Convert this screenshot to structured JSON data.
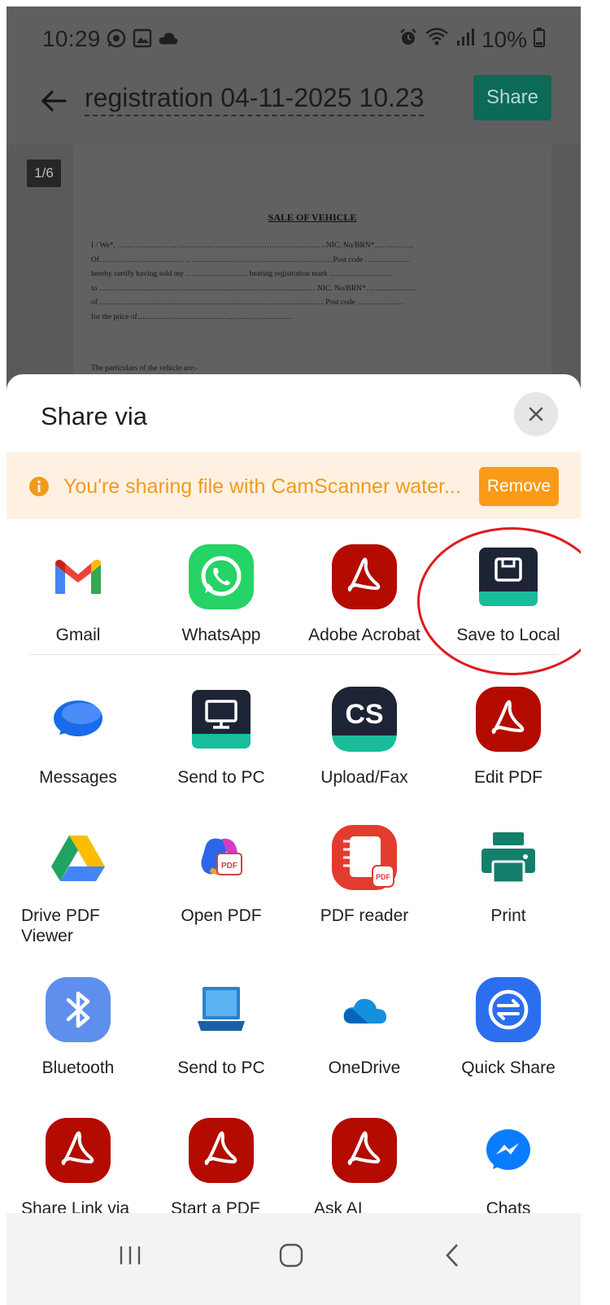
{
  "status_bar": {
    "time": "10:29",
    "battery": "10%",
    "left_icons": [
      "whatsapp-icon",
      "gallery-icon",
      "cloud-icon"
    ],
    "right_icons": [
      "alarm-icon",
      "wifi-icon",
      "signal-icon",
      "battery-icon"
    ]
  },
  "header": {
    "title": "registration 04-11-2025 10.23",
    "share_label": "Share"
  },
  "document": {
    "page_indicator": "1/6",
    "heading": "SALE OF VEHICLE",
    "lines": [
      "I / We*, ………………………………………………………………………NIC. No/BRN*……………",
      "Of…………………………… …………………………………………………Post code ………………",
      "hereby certify having sold my …………………… bearing registration mark ……………………",
      "to ………………………………………………………………………… NIC. No/BRN*. ………………",
      "of …………………………………………………………………………… Post code ………………",
      "for the price of……………………………………………………"
    ],
    "particulars": "The particulars of the vehicle are:-"
  },
  "sheet": {
    "title": "Share via",
    "banner_text": "You're sharing file with CamScanner water...",
    "remove_label": "Remove"
  },
  "apps": [
    [
      {
        "label": "Gmail",
        "icon": "gmail-icon"
      },
      {
        "label": "WhatsApp",
        "icon": "whatsapp-icon"
      },
      {
        "label": "Adobe Acrobat",
        "icon": "acrobat-icon"
      },
      {
        "label": "Save to Local",
        "icon": "save-icon"
      }
    ],
    [
      {
        "label": "Messages",
        "icon": "messages-icon"
      },
      {
        "label": "Send to PC",
        "icon": "monitor-icon"
      },
      {
        "label": "Upload/Fax",
        "icon": "camscanner-icon"
      },
      {
        "label": "Edit PDF",
        "icon": "acrobat-icon"
      }
    ],
    [
      {
        "label": "Drive PDF Viewer",
        "icon": "drive-icon"
      },
      {
        "label": "Open PDF",
        "icon": "copilot-pdf-icon"
      },
      {
        "label": "PDF reader",
        "icon": "pdf-reader-icon"
      },
      {
        "label": "Print",
        "icon": "printer-icon"
      }
    ],
    [
      {
        "label": "Bluetooth",
        "icon": "bluetooth-icon"
      },
      {
        "label": "Send to PC",
        "icon": "laptop-icon"
      },
      {
        "label": "OneDrive",
        "icon": "onedrive-icon"
      },
      {
        "label": "Quick Share",
        "icon": "quick-share-icon"
      }
    ],
    [
      {
        "label": "Share Link via Acrobat",
        "icon": "acrobat-icon"
      },
      {
        "label": "Start a PDF Space",
        "icon": "acrobat-icon"
      },
      {
        "label": "Ask AI Assistant",
        "icon": "acrobat-icon"
      },
      {
        "label": "Chats",
        "icon": "messenger-icon"
      }
    ]
  ],
  "nav": {
    "icons": [
      "recent-apps-icon",
      "home-icon",
      "back-icon"
    ]
  },
  "colors": {
    "share_green": "#0c6a58",
    "banner_bg": "#fff1e2",
    "banner_accent": "#fa9a17",
    "acrobat_red": "#b30b00",
    "annotation_red": "#e0191d"
  }
}
